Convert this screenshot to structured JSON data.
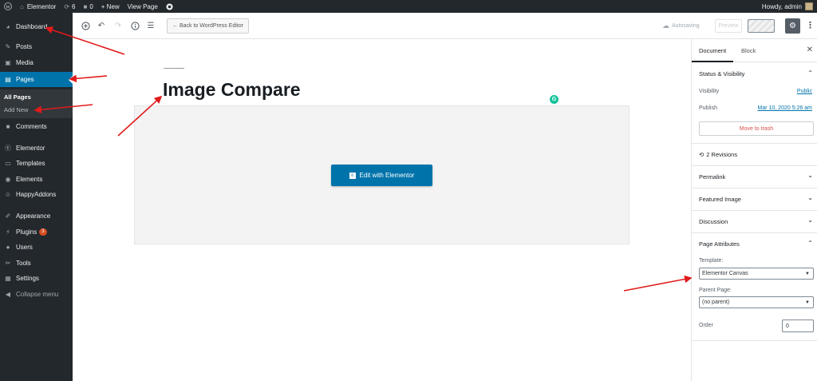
{
  "admin_bar": {
    "site_name": "Elementor",
    "updates_count": "6",
    "comments_count": "0",
    "new_label": "+ New",
    "view_page_label": "View Page",
    "greeting": "Howdy, admin"
  },
  "sidebar": {
    "items": [
      {
        "label": "Dashboard",
        "icon": "dashboard-icon"
      },
      {
        "label": "Posts",
        "icon": "pin-icon"
      },
      {
        "label": "Media",
        "icon": "media-icon"
      },
      {
        "label": "Pages",
        "icon": "pages-icon"
      },
      {
        "label": "Comments",
        "icon": "comment-icon"
      },
      {
        "label": "Elementor",
        "icon": "elementor-icon"
      },
      {
        "label": "Templates",
        "icon": "folder-icon"
      },
      {
        "label": "Elements",
        "icon": "elements-icon"
      },
      {
        "label": "HappyAddons",
        "icon": "happy-icon"
      },
      {
        "label": "Appearance",
        "icon": "brush-icon"
      },
      {
        "label": "Plugins",
        "icon": "plugin-icon",
        "badge": "3"
      },
      {
        "label": "Users",
        "icon": "users-icon"
      },
      {
        "label": "Tools",
        "icon": "wrench-icon"
      },
      {
        "label": "Settings",
        "icon": "settings-icon"
      },
      {
        "label": "Collapse menu",
        "icon": "collapse-icon"
      }
    ],
    "submenu": [
      {
        "label": "All Pages"
      },
      {
        "label": "Add New"
      }
    ]
  },
  "toolbar": {
    "back_label": "← Back to WordPress Editor",
    "autosave_label": "Autosaving",
    "preview_label": "Preview"
  },
  "editor": {
    "title": "Image Compare",
    "edit_button_label": "Edit with Elementor",
    "grammarly_label": "G"
  },
  "inspector": {
    "tabs": [
      {
        "label": "Document"
      },
      {
        "label": "Block"
      }
    ],
    "status_title": "Status & Visibility",
    "visibility_label": "Visibility",
    "visibility_value": "Public",
    "publish_label": "Publish",
    "publish_value": "Mar 10, 2020 5:26 am",
    "trash_label": "Move to trash",
    "revisions_label": "2 Revisions",
    "panels": [
      {
        "title": "Permalink"
      },
      {
        "title": "Featured Image"
      },
      {
        "title": "Discussion"
      }
    ],
    "attributes_title": "Page Attributes",
    "template_label": "Template:",
    "template_value": "Elementor Canvas",
    "parent_label": "Parent Page:",
    "parent_value": "(no parent)",
    "order_label": "Order",
    "order_value": "0"
  },
  "colors": {
    "admin_dark": "#23282d",
    "accent_blue": "#0073aa",
    "annotation_red": "#e01b1b"
  }
}
